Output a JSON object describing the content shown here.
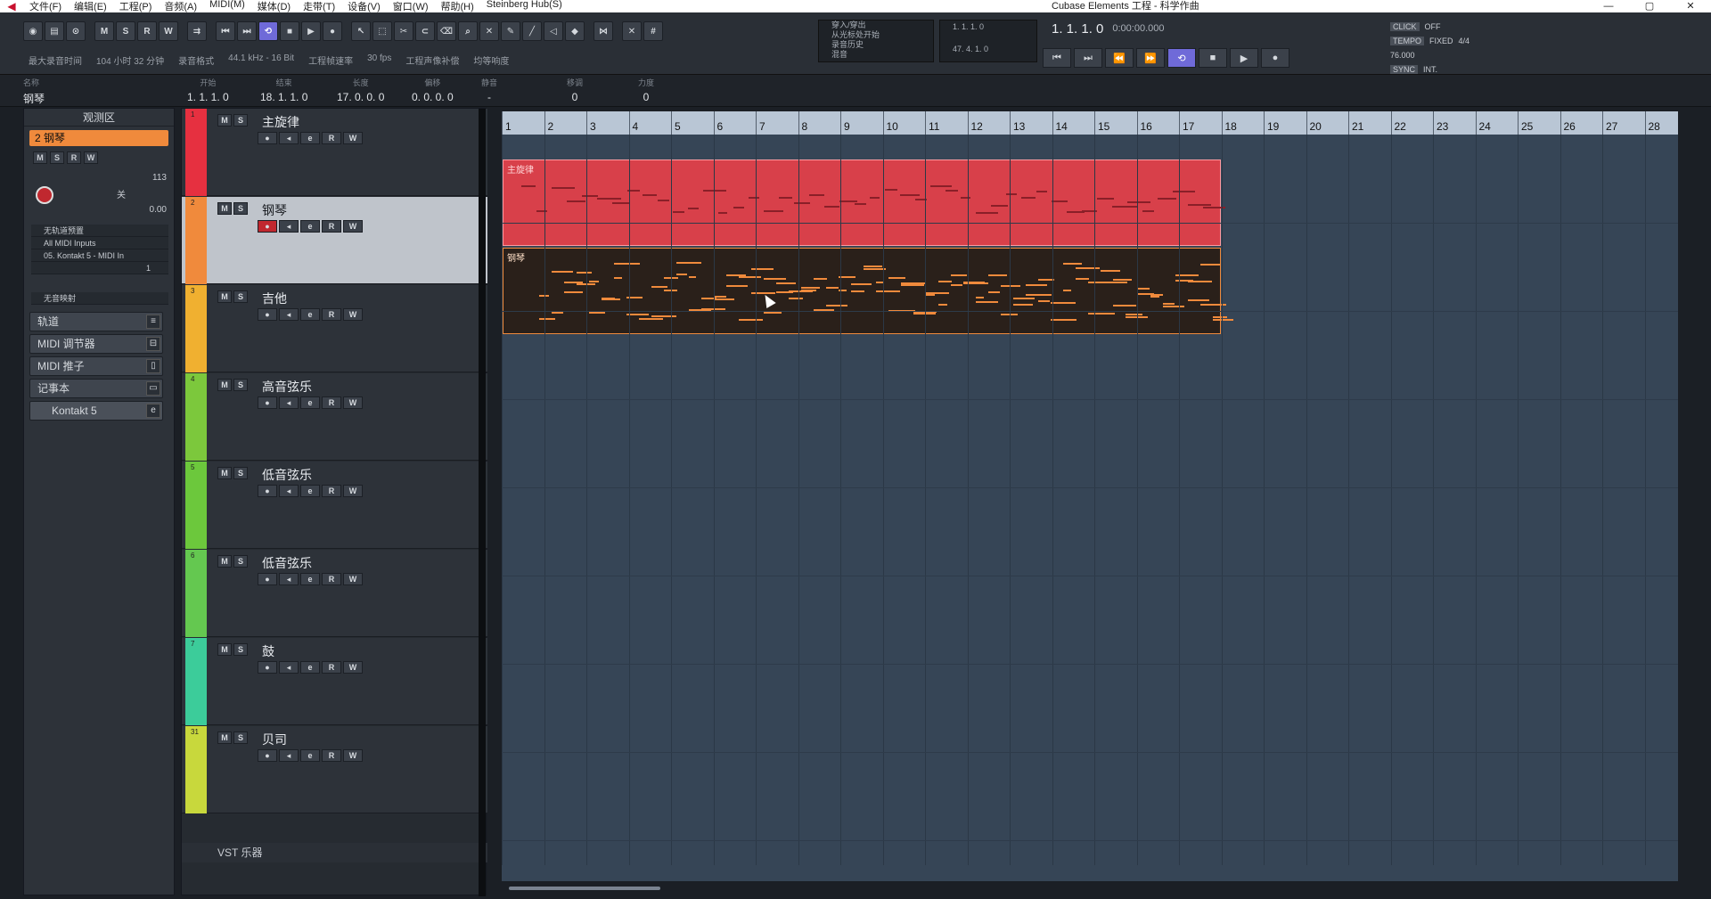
{
  "titlebar": {
    "menus": [
      "文件(F)",
      "编辑(E)",
      "工程(P)",
      "音频(A)",
      "MIDI(M)",
      "媒体(D)",
      "走带(T)",
      "设备(V)",
      "窗口(W)",
      "帮助(H)",
      "Steinberg Hub(S)"
    ],
    "title": "Cubase Elements 工程 - 科学作曲",
    "minimize": "—",
    "maximize": "▢",
    "close": "✕"
  },
  "toolbar": {
    "buttons": [
      "M",
      "S",
      "R",
      "W"
    ],
    "info": [
      "最大录音时间",
      "104 小时 32 分钟",
      "录音格式",
      "44.1 kHz - 16 Bit",
      "工程帧速率",
      "30 fps",
      "工程声像补偿",
      "均等响度"
    ],
    "transport_lines": [
      "穿入/穿出",
      "从光标处开始",
      "录音历史",
      "混音"
    ],
    "locators": {
      "L": "1. 1. 1. 0",
      "R": "47. 4. 1. 0"
    },
    "position": "1. 1. 1. 0",
    "time": "0:00:00.000",
    "click": {
      "label": "CLICK",
      "value": "OFF"
    },
    "tempo": {
      "label": "TEMPO",
      "value": "FIXED",
      "sig": "4/4",
      "bpm": "76.000"
    },
    "sync": {
      "label": "SYNC",
      "value": "INT."
    }
  },
  "infobar": {
    "name": {
      "key": "名称",
      "value": "钢琴"
    },
    "fields": [
      {
        "key": "开始",
        "value": "1. 1. 1. 0"
      },
      {
        "key": "结束",
        "value": "18. 1. 1. 0"
      },
      {
        "key": "长度",
        "value": "17. 0. 0. 0"
      },
      {
        "key": "偏移",
        "value": "0. 0. 0. 0"
      },
      {
        "key": "静音",
        "value": "-"
      },
      {
        "key": "移调",
        "value": "0"
      },
      {
        "key": "力度",
        "value": "0"
      }
    ]
  },
  "inspector": {
    "title": "观测区",
    "track_number": "2",
    "track_name": "钢琴",
    "vol": "113",
    "pan": "0.00",
    "pan_label": "关",
    "rows": [
      "无轨道预置",
      "All MIDI Inputs",
      "05. Kontakt 5 - MIDI In",
      "1",
      "无音映射"
    ],
    "sections": [
      "轨道",
      "MIDI 调节器",
      "MIDI 推子",
      "记事本",
      "Kontakt 5"
    ]
  },
  "tracks": [
    {
      "num": "1",
      "name": "主旋律",
      "color": "#e63040"
    },
    {
      "num": "2",
      "name": "钢琴",
      "color": "#f08a3c",
      "selected": true
    },
    {
      "num": "3",
      "name": "吉他",
      "color": "#f0b030"
    },
    {
      "num": "4",
      "name": "高音弦乐",
      "color": "#7cc83c"
    },
    {
      "num": "5",
      "name": "低音弦乐",
      "color": "#6cc83c"
    },
    {
      "num": "6",
      "name": "低音弦乐",
      "color": "#64c850"
    },
    {
      "num": "7",
      "name": "鼓",
      "color": "#3ccc9a"
    },
    {
      "num": "31",
      "name": "贝司",
      "color": "#c8d83c"
    }
  ],
  "vst_label": "VST 乐器",
  "ruler": [
    "1",
    "2",
    "3",
    "4",
    "5",
    "6",
    "7",
    "8",
    "9",
    "10",
    "11",
    "12",
    "13",
    "14",
    "15",
    "16",
    "17",
    "18",
    "19",
    "20",
    "21",
    "22",
    "23",
    "24",
    "25",
    "26",
    "27",
    "28"
  ],
  "parts": [
    {
      "name": "主旋律",
      "color": "#d8404a"
    },
    {
      "name": "钢琴",
      "color": "#f08a3c"
    }
  ]
}
